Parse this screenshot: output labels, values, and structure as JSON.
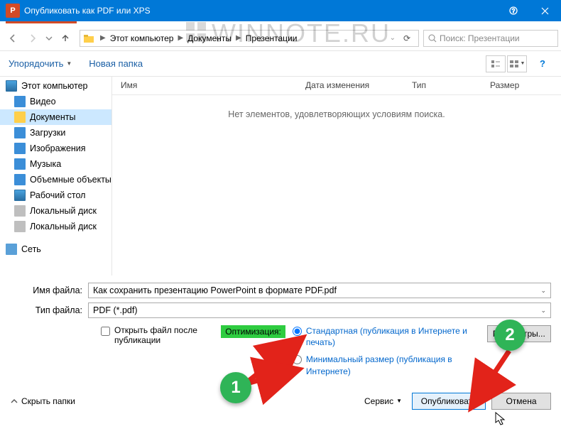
{
  "titlebar": {
    "title": "Опубликовать как PDF или XPS"
  },
  "watermark": "WINNOTE.RU",
  "path": {
    "root": "Этот компьютер",
    "p1": "Документы",
    "p2": "Презентации"
  },
  "search": {
    "placeholder": "Поиск: Презентации"
  },
  "toolbar": {
    "organize": "Упорядочить",
    "newfolder": "Новая папка"
  },
  "columns": {
    "name": "Имя",
    "date": "Дата изменения",
    "type": "Тип",
    "size": "Размер"
  },
  "empty": "Нет элементов, удовлетворяющих условиям поиска.",
  "sidebar": {
    "thispc": "Этот компьютер",
    "items": [
      "Видео",
      "Документы",
      "Загрузки",
      "Изображения",
      "Музыка",
      "Объемные объекты",
      "Рабочий стол",
      "Локальный диск",
      "Локальный диск"
    ],
    "network": "Сеть"
  },
  "form": {
    "filename_label": "Имя файла:",
    "filename": "Как сохранить презентацию PowerPoint в формате PDF.pdf",
    "filetype_label": "Тип файла:",
    "filetype": "PDF (*.pdf)",
    "openafter": "Открыть файл после публикации",
    "optimize": "Оптимизация:",
    "opt_standard": "Стандартная (публикация в Интернете и печать)",
    "opt_minimal": "Минимальный размер (публикация в Интернете)",
    "params": "Параметры..."
  },
  "actions": {
    "hidefolders": "Скрыть папки",
    "service": "Сервис",
    "publish": "Опубликовать",
    "cancel": "Отмена"
  },
  "annot": {
    "n1": "1",
    "n2": "2"
  }
}
